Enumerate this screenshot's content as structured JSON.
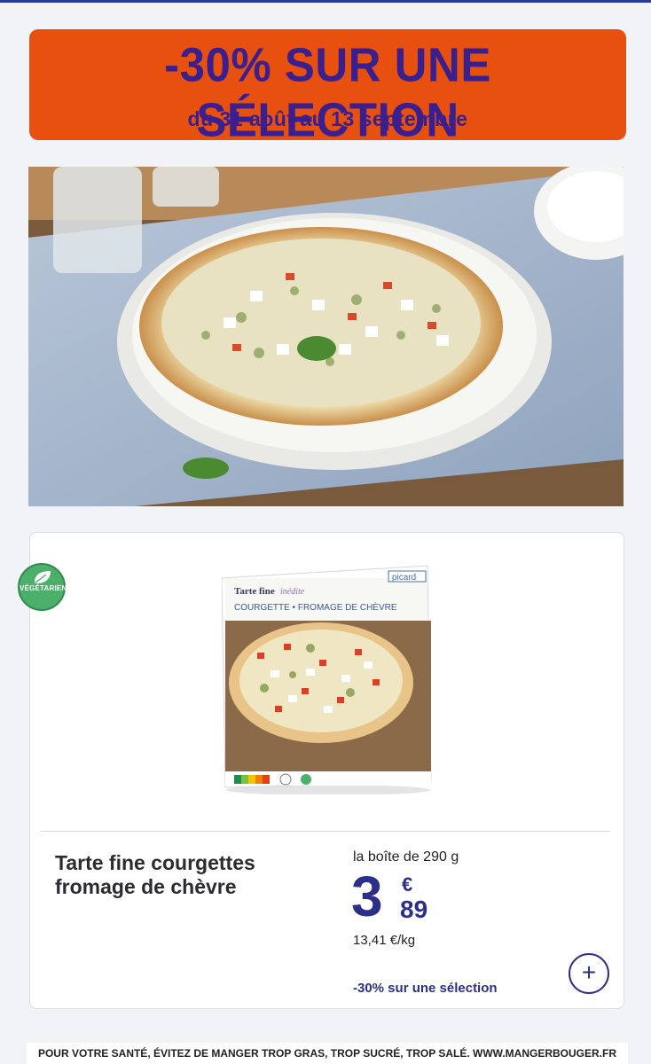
{
  "banner": {
    "title": "-30% SUR UNE SÉLECTION",
    "subtitle": "du 31 août au 13 septembre",
    "background_color": "#e8500f",
    "text_color": "#3a1f8f"
  },
  "hero": {
    "image": "photo-tarte-fine-on-plate"
  },
  "badge": {
    "label": "VÉGÉTARIEN",
    "icon": "leaf-icon",
    "color": "#4caf6a"
  },
  "packaging": {
    "brand": "picard",
    "line1": "Tarte fine",
    "line1_accent": "inédite",
    "line2": "COURGETTE • FROMAGE DE CHÈVRE",
    "nutriscore": [
      "A",
      "B",
      "C",
      "D",
      "E"
    ]
  },
  "product": {
    "name": "Tarte fine courgettes fromage de chèvre",
    "unit": "la boîte de 290 g",
    "price_integer": "3",
    "price_currency": "€",
    "price_decimals": "89",
    "price_per_kg": "13,41 €/kg",
    "promo_note": "-30% sur une sélection",
    "add_icon": "plus-icon",
    "accent_color": "#2b2f8a"
  },
  "footer": {
    "text": "POUR VOTRE SANTÉ, ÉVITEZ DE MANGER TROP GRAS, TROP SUCRÉ, TROP SALÉ. WWW.MANGERBOUGER.FR"
  }
}
